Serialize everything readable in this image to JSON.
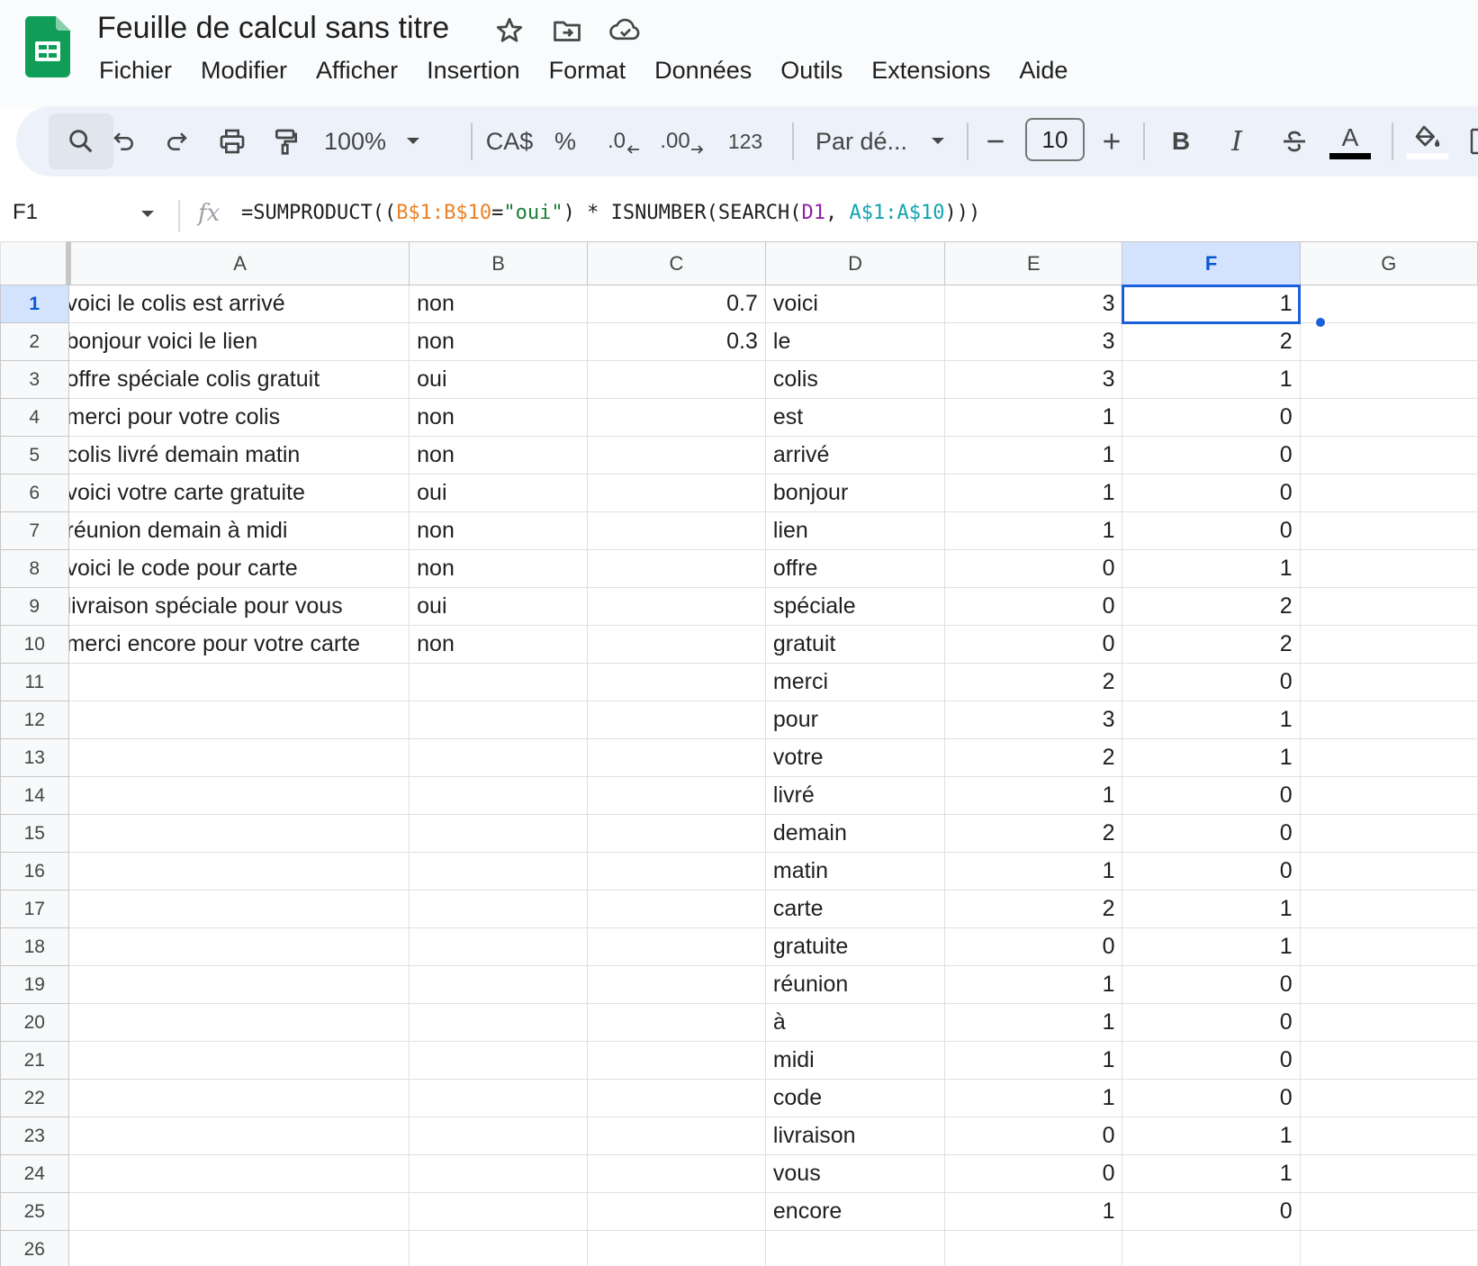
{
  "app": {
    "doc_title": "Feuille de calcul sans titre",
    "menus": [
      "Fichier",
      "Modifier",
      "Afficher",
      "Insertion",
      "Format",
      "Données",
      "Outils",
      "Extensions",
      "Aide"
    ]
  },
  "toolbar": {
    "zoom": "100%",
    "currency": "CA$",
    "percent": "%",
    "decrease_decimal": ".0",
    "increase_decimal": ".00",
    "number_format": "123",
    "font": "Par dé...",
    "font_size": "10",
    "bold": "B",
    "italic": "I",
    "text_color_glyph": "A",
    "text_color": "#000000"
  },
  "formula_bar": {
    "cell_ref": "F1",
    "fx": "fx",
    "formula_parts": [
      {
        "text": "=SUMPRODUCT((",
        "color": "default"
      },
      {
        "text": "B$1:B$10",
        "color": "orange"
      },
      {
        "text": "=",
        "color": "default"
      },
      {
        "text": "\"oui\"",
        "color": "green"
      },
      {
        "text": ") * ISNUMBER(SEARCH(",
        "color": "default"
      },
      {
        "text": "D1",
        "color": "purple"
      },
      {
        "text": ", ",
        "color": "default"
      },
      {
        "text": "A$1:A$10",
        "color": "teal"
      },
      {
        "text": ")))",
        "color": "default"
      }
    ]
  },
  "grid": {
    "columns": [
      "A",
      "B",
      "C",
      "D",
      "E",
      "F",
      "G"
    ],
    "active_column": "F",
    "active_row": 1,
    "active_cell": "F1",
    "rows": [
      {
        "n": "1",
        "A": "voici le colis est arrivé",
        "B": "non",
        "C": "0.7",
        "D": "voici",
        "E": "3",
        "F": "1"
      },
      {
        "n": "2",
        "A": "bonjour voici le lien",
        "B": "non",
        "C": "0.3",
        "D": "le",
        "E": "3",
        "F": "2"
      },
      {
        "n": "3",
        "A": "offre spéciale colis gratuit",
        "B": "oui",
        "C": "",
        "D": "colis",
        "E": "3",
        "F": "1"
      },
      {
        "n": "4",
        "A": "merci pour votre colis",
        "B": "non",
        "C": "",
        "D": "est",
        "E": "1",
        "F": "0"
      },
      {
        "n": "5",
        "A": "colis livré demain matin",
        "B": "non",
        "C": "",
        "D": "arrivé",
        "E": "1",
        "F": "0"
      },
      {
        "n": "6",
        "A": "voici votre carte gratuite",
        "B": "oui",
        "C": "",
        "D": "bonjour",
        "E": "1",
        "F": "0"
      },
      {
        "n": "7",
        "A": "réunion demain à midi",
        "B": "non",
        "C": "",
        "D": "lien",
        "E": "1",
        "F": "0"
      },
      {
        "n": "8",
        "A": "voici le code pour carte",
        "B": "non",
        "C": "",
        "D": "offre",
        "E": "0",
        "F": "1"
      },
      {
        "n": "9",
        "A": "livraison spéciale pour vous",
        "B": "oui",
        "C": "",
        "D": "spéciale",
        "E": "0",
        "F": "2"
      },
      {
        "n": "10",
        "A": "merci encore pour votre carte",
        "B": "non",
        "C": "",
        "D": "gratuit",
        "E": "0",
        "F": "2"
      },
      {
        "n": "11",
        "A": "",
        "B": "",
        "C": "",
        "D": "merci",
        "E": "2",
        "F": "0"
      },
      {
        "n": "12",
        "A": "",
        "B": "",
        "C": "",
        "D": "pour",
        "E": "3",
        "F": "1"
      },
      {
        "n": "13",
        "A": "",
        "B": "",
        "C": "",
        "D": "votre",
        "E": "2",
        "F": "1"
      },
      {
        "n": "14",
        "A": "",
        "B": "",
        "C": "",
        "D": "livré",
        "E": "1",
        "F": "0"
      },
      {
        "n": "15",
        "A": "",
        "B": "",
        "C": "",
        "D": "demain",
        "E": "2",
        "F": "0"
      },
      {
        "n": "16",
        "A": "",
        "B": "",
        "C": "",
        "D": "matin",
        "E": "1",
        "F": "0"
      },
      {
        "n": "17",
        "A": "",
        "B": "",
        "C": "",
        "D": "carte",
        "E": "2",
        "F": "1"
      },
      {
        "n": "18",
        "A": "",
        "B": "",
        "C": "",
        "D": "gratuite",
        "E": "0",
        "F": "1"
      },
      {
        "n": "19",
        "A": "",
        "B": "",
        "C": "",
        "D": "réunion",
        "E": "1",
        "F": "0"
      },
      {
        "n": "20",
        "A": "",
        "B": "",
        "C": "",
        "D": "à",
        "E": "1",
        "F": "0"
      },
      {
        "n": "21",
        "A": "",
        "B": "",
        "C": "",
        "D": "midi",
        "E": "1",
        "F": "0"
      },
      {
        "n": "22",
        "A": "",
        "B": "",
        "C": "",
        "D": "code",
        "E": "1",
        "F": "0"
      },
      {
        "n": "23",
        "A": "",
        "B": "",
        "C": "",
        "D": "livraison",
        "E": "0",
        "F": "1"
      },
      {
        "n": "24",
        "A": "",
        "B": "",
        "C": "",
        "D": "vous",
        "E": "0",
        "F": "1"
      },
      {
        "n": "25",
        "A": "",
        "B": "",
        "C": "",
        "D": "encore",
        "E": "1",
        "F": "0"
      },
      {
        "n": "26",
        "A": "",
        "B": "",
        "C": "",
        "D": "",
        "E": "",
        "F": ""
      }
    ]
  },
  "colors": {
    "accent": "#0b57d0",
    "selection": "#1a5fdc",
    "header_active": "#d3e3fd",
    "sheets_green": "#0f9d58"
  }
}
